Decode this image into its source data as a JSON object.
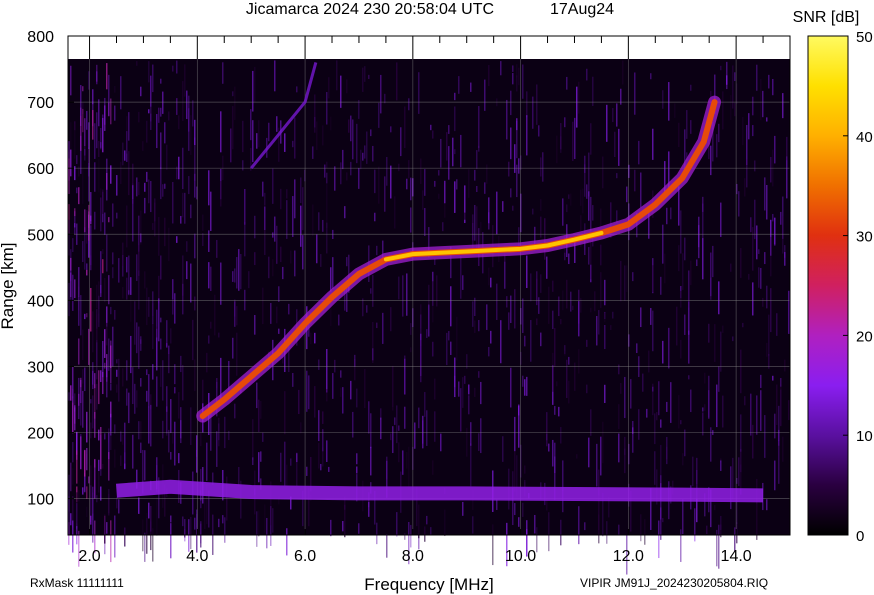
{
  "header": {
    "title": "Jicamarca 2024 230 20:58:04 UTC",
    "date": "17Aug24"
  },
  "footer": {
    "rxmask": "RxMask 11111111",
    "file_label": "VIPIR  JM91J_2024230205804.RIQ"
  },
  "colorbar": {
    "label": "SNR [dB]",
    "ticks": [
      "50",
      "40",
      "30",
      "20",
      "10",
      "0"
    ],
    "range": [
      0,
      50
    ],
    "stops": [
      "#000000",
      "#2a0040",
      "#5a10a0",
      "#8a1ef0",
      "#b020c0",
      "#d02060",
      "#e03010",
      "#f07000",
      "#ffb000",
      "#ffe000",
      "#fffa60"
    ]
  },
  "chart_data": {
    "type": "heatmap",
    "title": "Jicamarca 2024 230 20:58:04 UTC",
    "xlabel": "Frequency [MHz]",
    "ylabel": "Range [km]",
    "xlim": [
      1.6,
      15.0
    ],
    "ylim": [
      45,
      800
    ],
    "x_ticks": [
      "2.0",
      "4.0",
      "6.0",
      "8.0",
      "10.0",
      "12.0",
      "14.0"
    ],
    "y_ticks": [
      "100",
      "200",
      "300",
      "400",
      "500",
      "600",
      "700",
      "800"
    ],
    "grid": true,
    "colormap": "black-purple-red-orange-yellow",
    "traces": [
      {
        "name": "",
        "snr_db": 32,
        "points": [
          [
            4.1,
            225
          ],
          [
            4.5,
            250
          ],
          [
            5.0,
            285
          ],
          [
            5.5,
            320
          ],
          [
            6.0,
            365
          ],
          [
            6.5,
            405
          ],
          [
            7.0,
            440
          ],
          [
            7.5,
            462
          ],
          [
            8.0,
            470
          ],
          [
            8.5,
            472
          ],
          [
            9.0,
            474
          ],
          [
            9.5,
            476
          ],
          [
            10.0,
            478
          ],
          [
            10.5,
            483
          ],
          [
            11.0,
            492
          ],
          [
            11.5,
            502
          ],
          [
            12.0,
            515
          ],
          [
            12.5,
            545
          ],
          [
            13.0,
            585
          ],
          [
            13.4,
            640
          ],
          [
            13.6,
            700
          ]
        ]
      },
      {
        "name": "",
        "snr_db": 13,
        "points": [
          [
            5.0,
            600
          ],
          [
            5.5,
            650
          ],
          [
            6.0,
            700
          ],
          [
            6.2,
            760
          ]
        ]
      },
      {
        "name": "",
        "snr_db": 16,
        "points": [
          [
            2.5,
            112
          ],
          [
            3.5,
            118
          ],
          [
            5.0,
            110
          ],
          [
            7.0,
            108
          ],
          [
            9.0,
            108
          ],
          [
            11.0,
            107
          ],
          [
            13.0,
            106
          ],
          [
            14.5,
            105
          ]
        ]
      }
    ]
  }
}
